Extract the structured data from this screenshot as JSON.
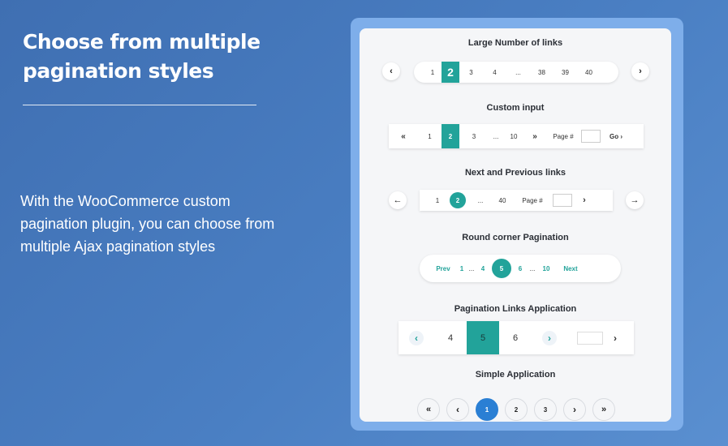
{
  "hero": {
    "title": "Choose from multiple pagination styles",
    "description": "With the WooCommerce custom pagination plugin, you can choose from multiple Ajax pagination styles"
  },
  "colors": {
    "accent": "#22a39a",
    "blue": "#2a7fd4",
    "background": "#4a7fc3"
  },
  "sections": {
    "large": {
      "title": "Large Number of links",
      "prev_icon": "chevron-left-icon",
      "next_icon": "chevron-right-icon",
      "prev": "‹",
      "next": "›",
      "items": [
        "1",
        "2",
        "3",
        "4",
        "...",
        "38",
        "39",
        "40"
      ],
      "active": "2"
    },
    "custom": {
      "title": "Custom input",
      "first": "«",
      "last": "»",
      "items": [
        "1",
        "2",
        "3",
        "...",
        "10"
      ],
      "active": "2",
      "page_label": "Page #",
      "go_label": "Go ›"
    },
    "next_prev": {
      "title": "Next and Previous links",
      "prev": "←",
      "next": "→",
      "items": [
        "1",
        "2",
        "...",
        "40"
      ],
      "active": "2",
      "page_label": "Page #",
      "go": "›"
    },
    "round": {
      "title": "Round corner Pagination",
      "prev": "Prev",
      "next": "Next",
      "items": [
        "1",
        "...",
        "4",
        "5",
        "6",
        "...",
        "10"
      ],
      "active": "5"
    },
    "app": {
      "title": "Pagination Links Application",
      "prev": "‹",
      "next": "›",
      "go": "›",
      "items": [
        "4",
        "5",
        "6"
      ],
      "active": "5"
    },
    "simple": {
      "title": "Simple Application",
      "first": "«",
      "prev": "‹",
      "next": "›",
      "last": "»",
      "items": [
        "1",
        "2",
        "3"
      ],
      "active": "1"
    }
  }
}
